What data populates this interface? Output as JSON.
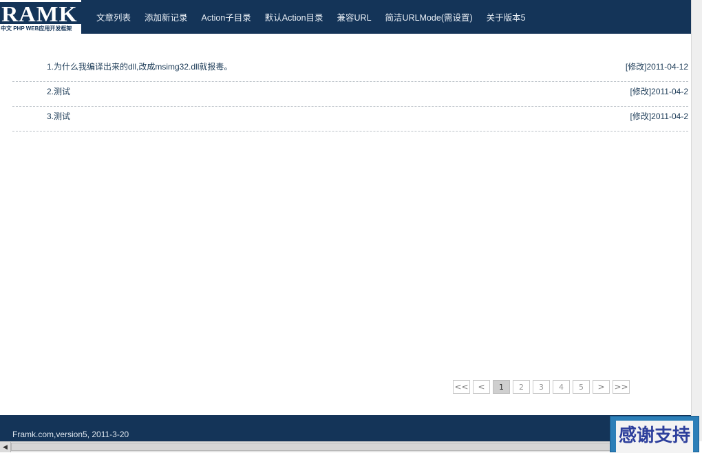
{
  "logo": {
    "mark": "RAMK",
    "subtitle": "中文 PHP WEB应用开发框架"
  },
  "nav": {
    "items": [
      {
        "label": "文章列表"
      },
      {
        "label": "添加新记录"
      },
      {
        "label": "Action子目录"
      },
      {
        "label": "默认Action目录"
      },
      {
        "label": "兼容URL"
      },
      {
        "label": "简洁URLMode(需设置)"
      },
      {
        "label": "关于版本5"
      }
    ]
  },
  "articles": [
    {
      "title": "1.为什么我编译出来的dll,改成msimg32.dll就报毒。",
      "edit_label": "[修改]",
      "date": "2011-04-12"
    },
    {
      "title": "2.测试",
      "edit_label": "[修改]",
      "date": "2011-04-2"
    },
    {
      "title": "3.测试",
      "edit_label": "[修改]",
      "date": "2011-04-2"
    }
  ],
  "pager": {
    "first": "<<",
    "prev": "<",
    "pages": [
      "1",
      "2",
      "3",
      "4",
      "5"
    ],
    "current": "1",
    "next": ">",
    "last": ">>"
  },
  "footer": {
    "text": "Framk.com,version5, 2011-3-20"
  },
  "badge": {
    "text": "感谢支持"
  },
  "scrollbar": {
    "left_arrow": "◀"
  }
}
